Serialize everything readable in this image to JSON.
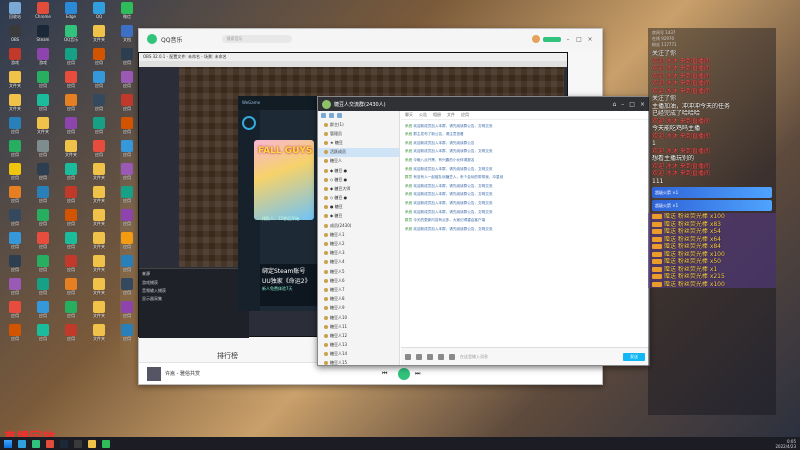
{
  "desktop": {
    "icons": [
      {
        "name": "recycle-bin-icon",
        "label": "回收站",
        "color": "#7aa9d6"
      },
      {
        "name": "chrome-icon",
        "label": "Chrome",
        "color": "#e24c3a"
      },
      {
        "name": "edge-icon",
        "label": "Edge",
        "color": "#2b8ad8"
      },
      {
        "name": "qq-icon",
        "label": "QQ",
        "color": "#2f9fe0"
      },
      {
        "name": "wechat-icon",
        "label": "微信",
        "color": "#2ebd59"
      },
      {
        "name": "obs-icon",
        "label": "OBS",
        "color": "#3a3a3a"
      },
      {
        "name": "steam-icon",
        "label": "Steam",
        "color": "#1b2838"
      },
      {
        "name": "qqmusic-icon",
        "label": "QQ音乐",
        "color": "#31c27c"
      },
      {
        "name": "folder-icon",
        "label": "文件夹",
        "color": "#f0c24a"
      },
      {
        "name": "doc-icon",
        "label": "文档",
        "color": "#3d6fc4"
      },
      {
        "name": "game-icon",
        "label": "游戏",
        "color": "#c0392b"
      },
      {
        "name": "game-icon",
        "label": "游戏",
        "color": "#8e44ad"
      },
      {
        "name": "app-icon",
        "label": "应用",
        "color": "#16a085"
      },
      {
        "name": "app-icon",
        "label": "应用",
        "color": "#d35400"
      },
      {
        "name": "app-icon",
        "label": "应用",
        "color": "#2c3e50"
      },
      {
        "name": "folder-icon",
        "label": "文件夹",
        "color": "#f0c24a"
      },
      {
        "name": "app-icon",
        "label": "应用",
        "color": "#27ae60"
      },
      {
        "name": "app-icon",
        "label": "应用",
        "color": "#e74c3c"
      },
      {
        "name": "app-icon",
        "label": "应用",
        "color": "#3498db"
      },
      {
        "name": "app-icon",
        "label": "应用",
        "color": "#9b59b6"
      },
      {
        "name": "folder-icon",
        "label": "文件夹",
        "color": "#f0c24a"
      },
      {
        "name": "app-icon",
        "label": "应用",
        "color": "#1abc9c"
      },
      {
        "name": "app-icon",
        "label": "应用",
        "color": "#e67e22"
      },
      {
        "name": "app-icon",
        "label": "应用",
        "color": "#34495e"
      },
      {
        "name": "app-icon",
        "label": "应用",
        "color": "#c0392b"
      },
      {
        "name": "app-icon",
        "label": "应用",
        "color": "#2980b9"
      },
      {
        "name": "folder-icon",
        "label": "文件夹",
        "color": "#f0c24a"
      },
      {
        "name": "app-icon",
        "label": "应用",
        "color": "#8e44ad"
      },
      {
        "name": "app-icon",
        "label": "应用",
        "color": "#16a085"
      },
      {
        "name": "app-icon",
        "label": "应用",
        "color": "#d35400"
      },
      {
        "name": "app-icon",
        "label": "应用",
        "color": "#27ae60"
      },
      {
        "name": "app-icon",
        "label": "应用",
        "color": "#7f8c8d"
      },
      {
        "name": "folder-icon",
        "label": "文件夹",
        "color": "#f0c24a"
      },
      {
        "name": "app-icon",
        "label": "应用",
        "color": "#e74c3c"
      },
      {
        "name": "app-icon",
        "label": "应用",
        "color": "#3498db"
      },
      {
        "name": "app-icon",
        "label": "应用",
        "color": "#f1c40f"
      },
      {
        "name": "app-icon",
        "label": "应用",
        "color": "#2c3e50"
      },
      {
        "name": "app-icon",
        "label": "应用",
        "color": "#1abc9c"
      },
      {
        "name": "folder-icon",
        "label": "文件夹",
        "color": "#f0c24a"
      },
      {
        "name": "app-icon",
        "label": "应用",
        "color": "#9b59b6"
      },
      {
        "name": "app-icon",
        "label": "应用",
        "color": "#e67e22"
      },
      {
        "name": "app-icon",
        "label": "应用",
        "color": "#2980b9"
      },
      {
        "name": "app-icon",
        "label": "应用",
        "color": "#c0392b"
      },
      {
        "name": "folder-icon",
        "label": "文件夹",
        "color": "#f0c24a"
      },
      {
        "name": "app-icon",
        "label": "应用",
        "color": "#16a085"
      },
      {
        "name": "app-icon",
        "label": "应用",
        "color": "#34495e"
      },
      {
        "name": "app-icon",
        "label": "应用",
        "color": "#27ae60"
      },
      {
        "name": "app-icon",
        "label": "应用",
        "color": "#d35400"
      },
      {
        "name": "folder-icon",
        "label": "文件夹",
        "color": "#f0c24a"
      },
      {
        "name": "app-icon",
        "label": "应用",
        "color": "#8e44ad"
      },
      {
        "name": "app-icon",
        "label": "应用",
        "color": "#3498db"
      },
      {
        "name": "app-icon",
        "label": "应用",
        "color": "#e74c3c"
      },
      {
        "name": "app-icon",
        "label": "应用",
        "color": "#1abc9c"
      },
      {
        "name": "folder-icon",
        "label": "文件夹",
        "color": "#f0c24a"
      },
      {
        "name": "app-icon",
        "label": "应用",
        "color": "#f39c12"
      },
      {
        "name": "app-icon",
        "label": "应用",
        "color": "#2c3e50"
      },
      {
        "name": "app-icon",
        "label": "应用",
        "color": "#27ae60"
      },
      {
        "name": "app-icon",
        "label": "应用",
        "color": "#c0392b"
      },
      {
        "name": "folder-icon",
        "label": "文件夹",
        "color": "#f0c24a"
      },
      {
        "name": "app-icon",
        "label": "应用",
        "color": "#2980b9"
      },
      {
        "name": "app-icon",
        "label": "应用",
        "color": "#9b59b6"
      },
      {
        "name": "app-icon",
        "label": "应用",
        "color": "#16a085"
      },
      {
        "name": "app-icon",
        "label": "应用",
        "color": "#e67e22"
      },
      {
        "name": "folder-icon",
        "label": "文件夹",
        "color": "#f0c24a"
      },
      {
        "name": "app-icon",
        "label": "应用",
        "color": "#34495e"
      },
      {
        "name": "app-icon",
        "label": "应用",
        "color": "#e74c3c"
      },
      {
        "name": "app-icon",
        "label": "应用",
        "color": "#3498db"
      },
      {
        "name": "app-icon",
        "label": "应用",
        "color": "#27ae60"
      },
      {
        "name": "folder-icon",
        "label": "文件夹",
        "color": "#f0c24a"
      },
      {
        "name": "app-icon",
        "label": "应用",
        "color": "#8e44ad"
      },
      {
        "name": "app-icon",
        "label": "应用",
        "color": "#d35400"
      },
      {
        "name": "app-icon",
        "label": "应用",
        "color": "#1abc9c"
      },
      {
        "name": "app-icon",
        "label": "应用",
        "color": "#c0392b"
      },
      {
        "name": "folder-icon",
        "label": "文件夹",
        "color": "#f0c24a"
      },
      {
        "name": "app-icon",
        "label": "应用",
        "color": "#2980b9"
      }
    ],
    "watermark": "直播回放"
  },
  "qqmusic": {
    "title": "QQ音乐",
    "search_placeholder": "搜索音乐",
    "heading": "排行榜",
    "now_playing": "许嵩 - 雅俗共赏"
  },
  "obs": {
    "title": "OBS 32.0.1 - 配置文件: 未命名 - 场景: 未命名",
    "panel_title": "来源",
    "panel_rows": [
      "游戏捕获",
      "音频输入捕获",
      "显示器采集"
    ]
  },
  "launcher": {
    "title": "WeGame",
    "art_title": "FALL GUYS",
    "hint": "排队人：15秒后开始",
    "banner_line1": "绑定Steam账号",
    "banner_line2": "UU独家《命运2》",
    "banner_line3": "新人免费体验7天"
  },
  "qqchat": {
    "title": "糖豆人交流群(2430人)",
    "tabs": [
      "聊天",
      "公告",
      "相册",
      "文件",
      "应用"
    ],
    "members": [
      "群主(1)",
      "管理员",
      "★ 糖豆",
      "活跃成员",
      "糖豆人",
      "◆ 糖豆 ●",
      "◇ 糖豆 ●",
      "◆ 糖豆大师",
      "◇ 糖豆 ●",
      "● 糖豆",
      "◆ 糖豆",
      "成员(2430)",
      "糖豆人1",
      "糖豆人2",
      "糖豆人3",
      "糖豆人4",
      "糖豆人5",
      "糖豆人6",
      "糖豆人7",
      "糖豆人8",
      "糖豆人9",
      "糖豆人10",
      "糖豆人11",
      "糖豆人12",
      "糖豆人13",
      "糖豆人14",
      "糖豆人15"
    ],
    "messages": [
      {
        "sender": "系统",
        "text": "欢迎新成员加入本群，请先阅读群公告，文明交流"
      },
      {
        "sender": "系统",
        "text": "群主发布了新公告，请注意查看"
      },
      {
        "sender": "系统",
        "text": "欢迎新成员加入本群，请先阅读群公告"
      },
      {
        "sender": "系统",
        "text": "欢迎新成员加入本群，请先阅读群公告，文明交流"
      },
      {
        "sender": "系统",
        "text": "今晚八点开黑，有兴趣的小伙伴请报名"
      },
      {
        "sender": "系统",
        "text": "欢迎新成员加入本群，请先阅读群公告，文明交流"
      },
      {
        "sender": "群员",
        "text": "有没有人一起组队玩糖豆人，来个会玩的带带我，冲皇冠"
      },
      {
        "sender": "系统",
        "text": "欢迎新成员加入本群，请先阅读群公告，文明交流"
      },
      {
        "sender": "系统",
        "text": "欢迎新成员加入本群，请先阅读群公告，文明交流"
      },
      {
        "sender": "系统",
        "text": "欢迎新成员加入本群，请先阅读群公告，文明交流"
      },
      {
        "sender": "系统",
        "text": "欢迎新成员加入本群，请先阅读群公告，文明交流"
      },
      {
        "sender": "群员",
        "text": "今天的更新内容有点多，大家记得重启客户端"
      },
      {
        "sender": "系统",
        "text": "欢迎新成员加入本群，请先阅读群公告，文明交流"
      }
    ],
    "send_label": "发送",
    "input_hint": "在这里输入消息"
  },
  "danmaku": {
    "header": [
      "房间号 1437",
      "在线 92970",
      "粉丝 117771"
    ],
    "lines": [
      {
        "text": "关注了你",
        "style": "white"
      },
      {
        "text": "欢迎 冰沐 来到直播间",
        "style": "red"
      },
      {
        "text": "欢迎 冰沐 来到直播间",
        "style": "red"
      },
      {
        "text": "欢迎 冰沐 来到直播间",
        "style": "red"
      },
      {
        "text": "欢迎 冰沐 来到直播间",
        "style": "red"
      },
      {
        "text": "欢迎 冰沐 来到直播间",
        "style": "red"
      },
      {
        "text": "关注了你",
        "style": "white"
      },
      {
        "text": "主播加油，冲冲冲今天的任务",
        "style": "white"
      },
      {
        "text": "已经完成了哈哈哈",
        "style": "white"
      },
      {
        "text": "欢迎 冰沐 来到直播间",
        "style": "red"
      },
      {
        "text": "今天能吃鸡吗主播",
        "style": "white"
      },
      {
        "text": "欢迎 冰沐 来到直播间",
        "style": "red"
      },
      {
        "text": "1",
        "style": "white"
      },
      {
        "text": "欢迎 冰沐 来到直播间",
        "style": "red"
      },
      {
        "text": "想看主播玩别的",
        "style": "white"
      },
      {
        "text": "欢迎 冰沐 来到直播间",
        "style": "red"
      },
      {
        "text": "欢迎 冰沐 来到直播间",
        "style": "red"
      },
      {
        "text": "111",
        "style": "white"
      }
    ],
    "gifts": [
      {
        "text": "赠送 粉丝荧光棒 x100",
        "style": "gift"
      },
      {
        "text": "赠送 粉丝荧光棒 x83",
        "style": "gift"
      },
      {
        "text": "赠送 粉丝荧光棒 x54",
        "style": "gift"
      },
      {
        "text": "赠送 粉丝荧光棒 x64",
        "style": "gift"
      },
      {
        "text": "赠送 粉丝荧光棒 x84",
        "style": "gift"
      },
      {
        "text": "赠送 粉丝荧光棒 x100",
        "style": "gift"
      },
      {
        "text": "赠送 粉丝荧光棒 x50",
        "style": "gift"
      },
      {
        "text": "赠送 粉丝荧光棒 x1",
        "style": "gift"
      },
      {
        "text": "赠送 粉丝荧光棒 x215",
        "style": "gift"
      },
      {
        "text": "赠送 粉丝荧光棒 x100",
        "style": "gift"
      }
    ],
    "gift_cards": [
      "超级火箭 ×1",
      "超级火箭 ×1"
    ]
  },
  "taskbar": {
    "apps": [
      "#2f9fe0",
      "#31c27c",
      "#e24c3a",
      "#1b2838",
      "#3a3a3a",
      "#f0c24a",
      "#2ebd59"
    ],
    "time": "0:05",
    "date": "2022/4/23"
  }
}
